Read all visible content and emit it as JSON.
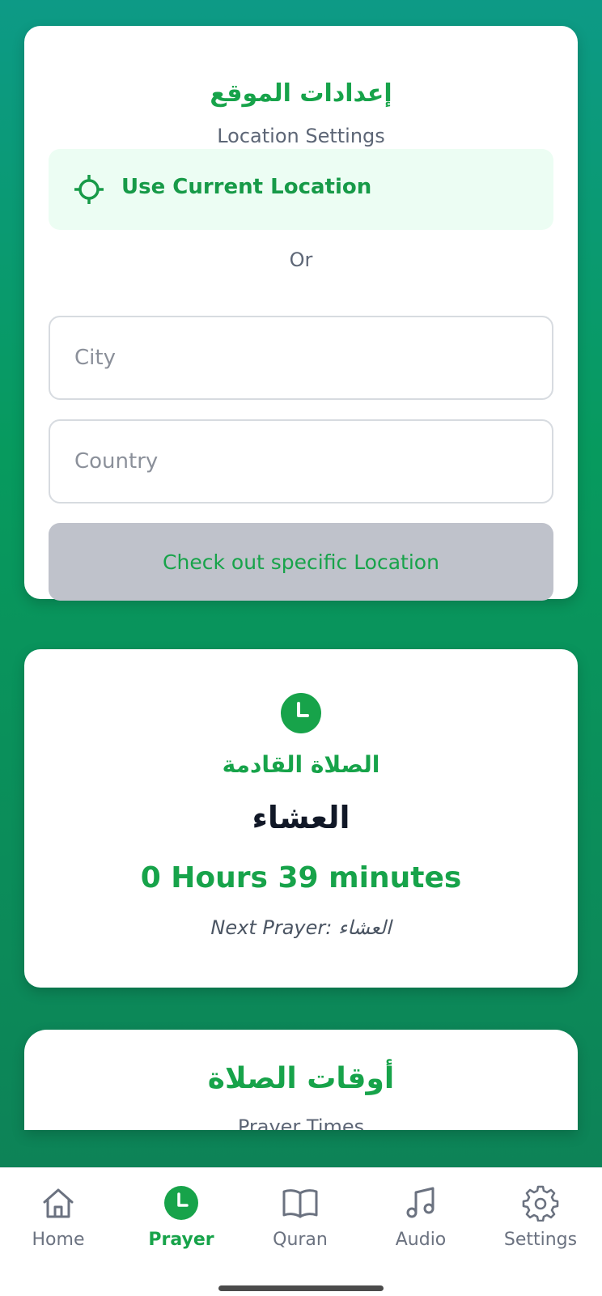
{
  "location": {
    "title_ar": "إعدادات الموقع",
    "title_en": "Location Settings",
    "use_current": "Use Current Location",
    "or": "Or",
    "city_placeholder": "City",
    "country_placeholder": "Country",
    "check_button": "Check out specific Location"
  },
  "next_prayer": {
    "heading_ar": "الصلاة القادمة",
    "name_ar": "العشاء",
    "countdown": "0 Hours 39 minutes",
    "next_line": "Next Prayer: العشاء"
  },
  "prayer_times": {
    "title_ar": "أوقات الصلاة",
    "title_en": "Prayer Times"
  },
  "nav": {
    "home": "Home",
    "prayer": "Prayer",
    "quran": "Quran",
    "audio": "Audio",
    "settings": "Settings"
  },
  "colors": {
    "accent": "#17a34a",
    "bg_top": "#0d9a86",
    "bg_bottom": "#0e7f56"
  }
}
